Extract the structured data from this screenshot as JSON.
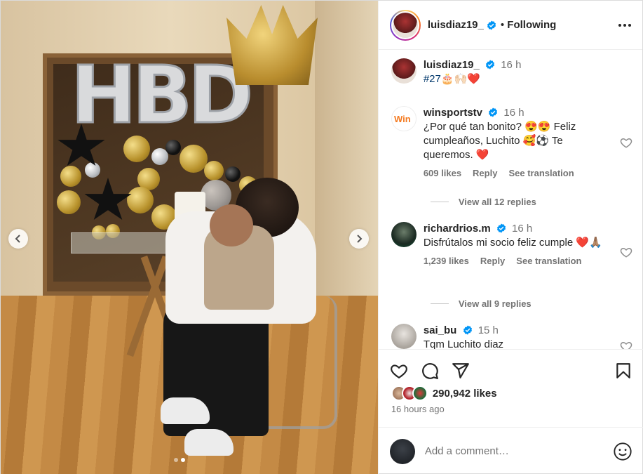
{
  "post": {
    "author": "luisdiaz19_",
    "follow_status": "Following",
    "caption_time": "16 h",
    "caption": "#27🎂🙌🏻❤️",
    "likes": "290,942 likes",
    "time_ago": "16 hours ago",
    "carousel": {
      "total": 2,
      "current": 2
    },
    "hbd_text": "HBD"
  },
  "comments": [
    {
      "username": "winsportstv",
      "time": "16 h",
      "text": "¿Por qué tan bonito? 😍😍 Feliz cumpleaños, Luchito 🥰⚽ Te queremos. ❤️",
      "likes": "609 likes",
      "reply": "Reply",
      "translate": "See translation",
      "view_replies": "View all 12 replies"
    },
    {
      "username": "richardrios.m",
      "time": "16 h",
      "text": "Disfrútalos mi socio feliz cumple ❤️🙏🏽",
      "likes": "1,239 likes",
      "reply": "Reply",
      "translate": "See translation",
      "view_replies": "View all 9 replies"
    },
    {
      "username": "sai_bu",
      "time": "15 h",
      "text": "Tqm Luchito diaz"
    }
  ],
  "comment_input": {
    "placeholder": "Add a comment…"
  },
  "colors": {
    "accent": "#0095f6",
    "verified": "#0095f6",
    "heart": "#ed4956"
  },
  "icons": [
    "heart-icon",
    "comment-icon",
    "share-icon",
    "bookmark-icon",
    "emoji-icon",
    "more-icon",
    "chevron-left-icon",
    "chevron-right-icon",
    "verified-badge-icon"
  ]
}
